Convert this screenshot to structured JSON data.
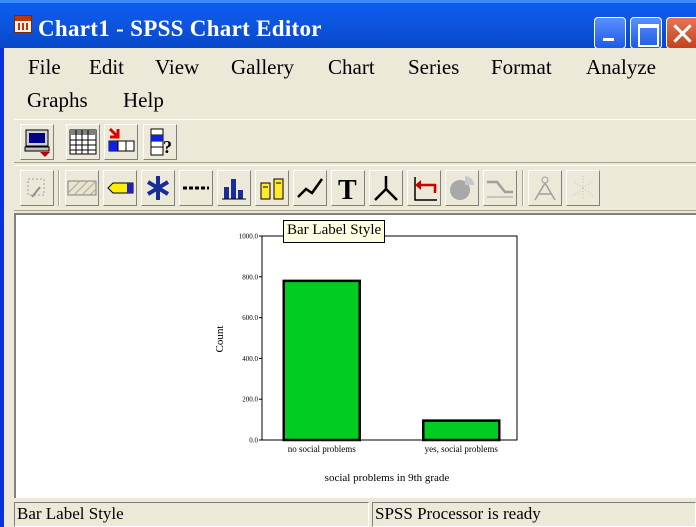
{
  "window": {
    "title": "Chart1 - SPSS Chart Editor",
    "icon": "chart-app-icon",
    "controls": [
      "minimize-icon",
      "maximize-icon",
      "close-icon"
    ]
  },
  "menu": [
    {
      "label": "File"
    },
    {
      "label": "Edit"
    },
    {
      "label": "View"
    },
    {
      "label": "Gallery"
    },
    {
      "label": "Chart"
    },
    {
      "label": "Series"
    },
    {
      "label": "Format"
    },
    {
      "label": "Analyze"
    },
    {
      "label": "Graphs"
    },
    {
      "label": "Help"
    }
  ],
  "toolbar1": [
    "refresh-screen-icon",
    "data-editor-grid-icon",
    "goto-case-icon",
    "variables-help-icon"
  ],
  "toolbar2": [
    "select-object-icon",
    "fill-pattern-icon",
    "color-pencil-icon",
    "marker-asterisk-icon",
    "line-style-icon",
    "bar-style-icon",
    "bar-label-style-icon",
    "interpolation-line-icon",
    "text-tool-icon",
    "3d-rotation-icon",
    "swap-axes-icon",
    "explode-slice-icon",
    "break-line-icon",
    "spikes-icon",
    "reference-line-icon"
  ],
  "tooltip": "Bar Label Style",
  "status": {
    "left": "Bar Label Style",
    "right": "SPSS Processor  is ready"
  },
  "colors": {
    "bar_fill": "#00cc22",
    "title_bar": "#0a5ef0",
    "frame": "#ece9d8"
  },
  "chart_data": {
    "type": "bar",
    "categories": [
      "no social problems",
      "yes, social problems"
    ],
    "values": [
      780,
      95
    ],
    "ylabel": "Count",
    "xlabel": "social problems in 9th grade",
    "ylim": [
      0,
      1000
    ],
    "y_ticks": [
      0,
      200,
      400,
      600,
      800,
      1000
    ],
    "y_tick_labels": [
      "0.0",
      "200.0",
      "400.0",
      "600.0",
      "800.0",
      "1000.0"
    ],
    "grid": false,
    "legend": "none"
  }
}
